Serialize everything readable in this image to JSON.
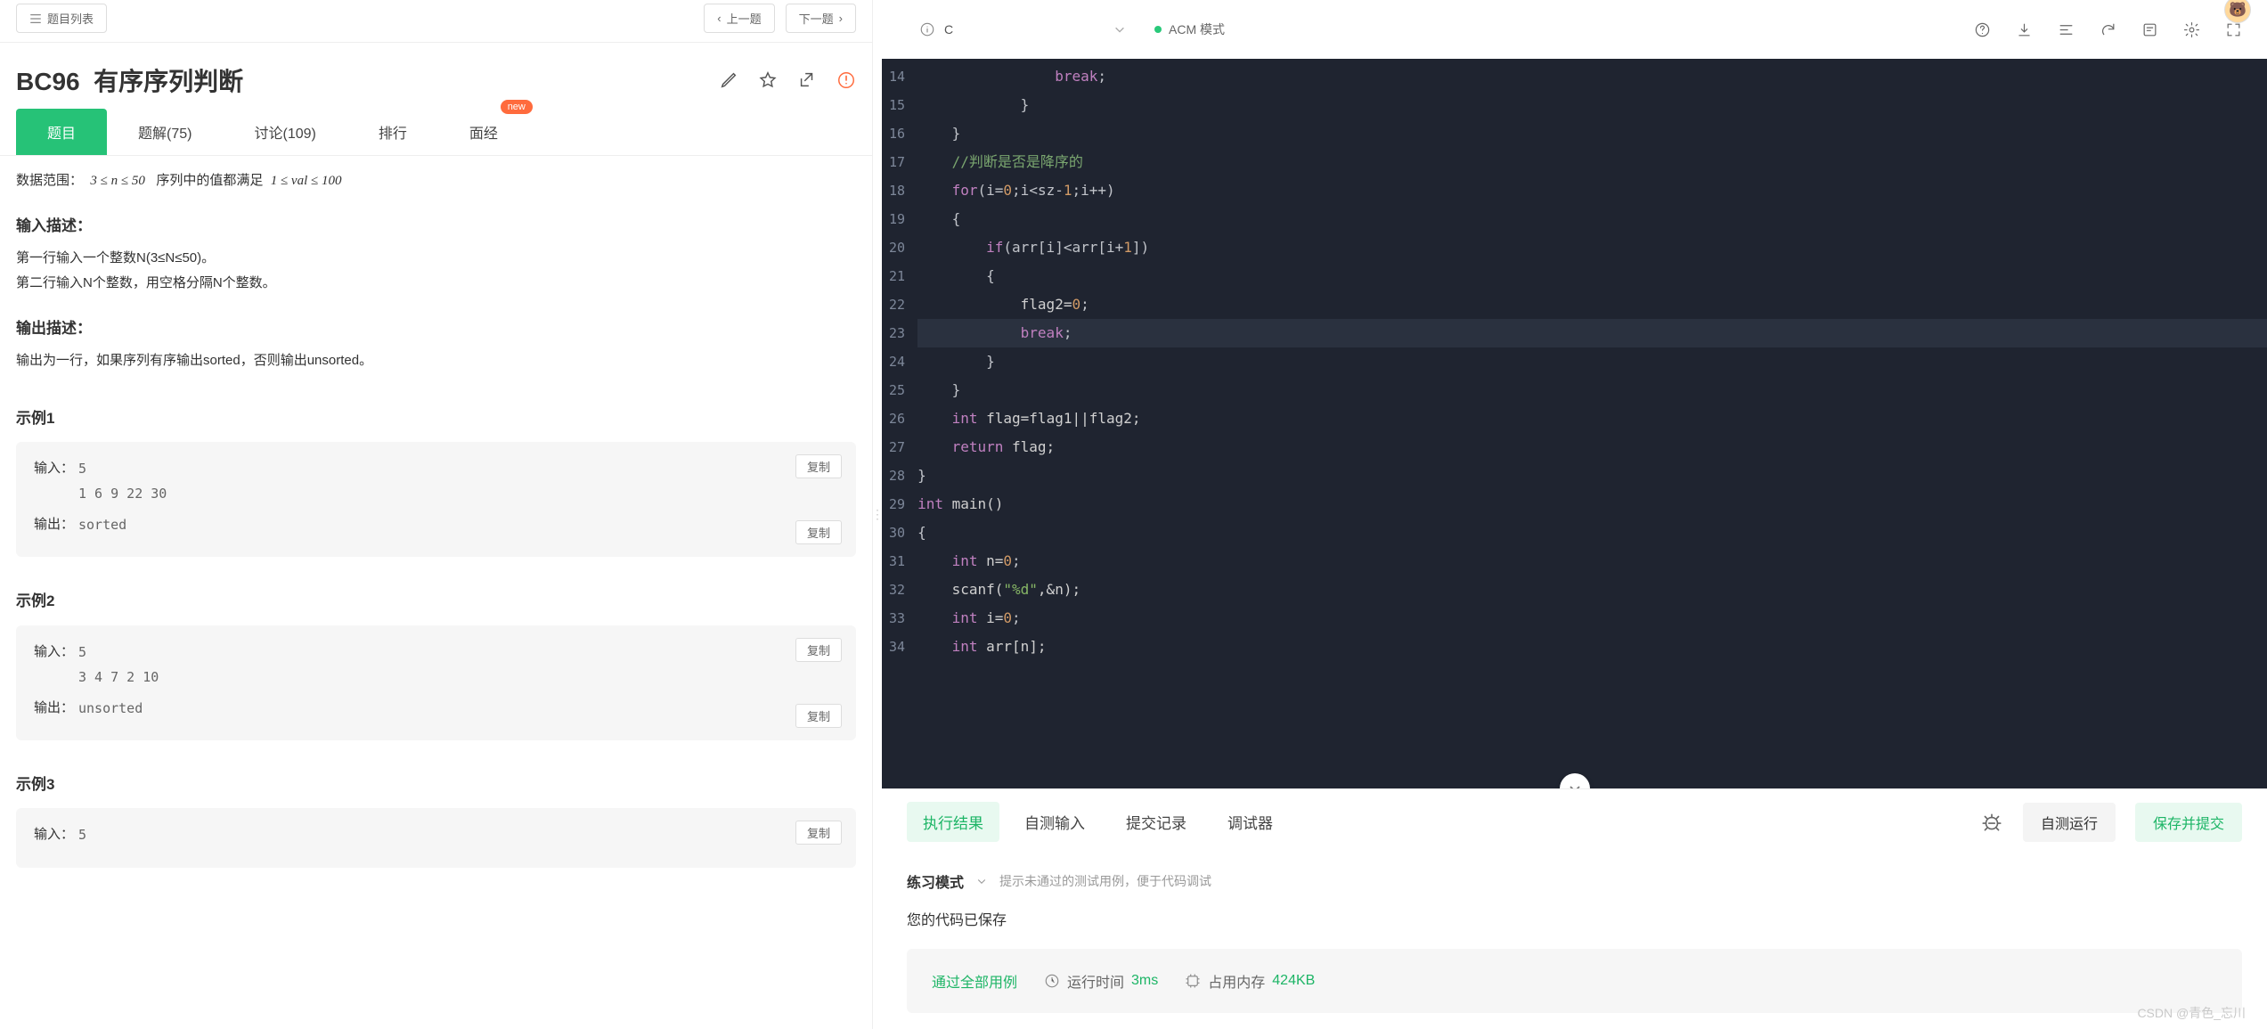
{
  "topnav": {
    "list": "题目列表",
    "prev": "上一题",
    "next": "下一题"
  },
  "problem": {
    "code": "BC96",
    "title": "有序序列判断"
  },
  "ptabs": {
    "desc": "题目",
    "solution": "题解(75)",
    "discuss": "讨论(109)",
    "rank": "排行",
    "exp": "面经",
    "new": "new"
  },
  "body": {
    "range_label": "数据范围：",
    "range_math": "3 ≤ n ≤ 50",
    "range_mid": "序列中的值都满足",
    "range_math2": "1 ≤ val ≤ 100",
    "in_h": "输入描述：",
    "in_l1": "第一行输入一个整数N(3≤N≤50)。",
    "in_l2": "第二行输入N个整数，用空格分隔N个整数。",
    "out_h": "输出描述：",
    "out_l1": "输出为一行，如果序列有序输出sorted，否则输出unsorted。"
  },
  "samples": {
    "s1": "示例1",
    "s2": "示例2",
    "s3": "示例3",
    "lbl_in": "输入：",
    "lbl_out": "输出：",
    "copy": "复制",
    "e1_in": "5\n1 6 9 22 30",
    "e1_out": "sorted",
    "e2_in": "5\n3 4 7 2 10",
    "e2_out": "unsorted",
    "e3_in": "5"
  },
  "editor": {
    "lang": "C",
    "mode": "ACM 模式",
    "lines": [
      {
        "n": 14,
        "t": "                break;",
        "hl": false,
        "seg": [
          {
            "c": "kw",
            "t": "break"
          },
          {
            "c": "bk",
            "t": ";"
          }
        ],
        "ind": 16
      },
      {
        "n": 15,
        "t": "            }",
        "seg": [
          {
            "c": "bk",
            "t": "}"
          }
        ],
        "ind": 12
      },
      {
        "n": 16,
        "t": "    }",
        "seg": [
          {
            "c": "bk",
            "t": "}"
          }
        ],
        "ind": 4
      },
      {
        "n": 17,
        "t": "    //判断是否是降序的",
        "seg": [
          {
            "c": "cmt",
            "t": "//判断是否是降序的"
          }
        ],
        "ind": 4
      },
      {
        "n": 18,
        "t": "    for(i=0;i<sz-1;i++)",
        "seg": [
          {
            "c": "kw",
            "t": "for"
          },
          {
            "c": "bk",
            "t": "(i="
          },
          {
            "c": "num",
            "t": "0"
          },
          {
            "c": "bk",
            "t": ";i<sz-"
          },
          {
            "c": "num",
            "t": "1"
          },
          {
            "c": "bk",
            "t": ";i++)"
          }
        ],
        "ind": 4
      },
      {
        "n": 19,
        "t": "    {",
        "seg": [
          {
            "c": "bk",
            "t": "{"
          }
        ],
        "ind": 4
      },
      {
        "n": 20,
        "t": "        if(arr[i]<arr[i+1])",
        "seg": [
          {
            "c": "kw",
            "t": "if"
          },
          {
            "c": "bk",
            "t": "(arr[i]<arr[i+"
          },
          {
            "c": "num",
            "t": "1"
          },
          {
            "c": "bk",
            "t": "])"
          }
        ],
        "ind": 8
      },
      {
        "n": 21,
        "t": "        {",
        "seg": [
          {
            "c": "bk",
            "t": "{"
          }
        ],
        "ind": 8,
        "box": true
      },
      {
        "n": 22,
        "t": "            flag2=0;",
        "seg": [
          {
            "c": "id",
            "t": "flag2="
          },
          {
            "c": "num",
            "t": "0"
          },
          {
            "c": "bk",
            "t": ";"
          }
        ],
        "ind": 12
      },
      {
        "n": 23,
        "t": "            break;",
        "hl": true,
        "seg": [
          {
            "c": "kw",
            "t": "break"
          },
          {
            "c": "bk",
            "t": ";"
          }
        ],
        "ind": 12
      },
      {
        "n": 24,
        "t": "        }",
        "seg": [
          {
            "c": "bk",
            "t": "}"
          }
        ],
        "ind": 8,
        "box": true
      },
      {
        "n": 25,
        "t": "    }",
        "seg": [
          {
            "c": "bk",
            "t": "}"
          }
        ],
        "ind": 4
      },
      {
        "n": 26,
        "t": "    int flag=flag1||flag2;",
        "seg": [
          {
            "c": "kw",
            "t": "int"
          },
          {
            "c": "id",
            "t": " flag=flag1||flag2;"
          }
        ],
        "ind": 4
      },
      {
        "n": 27,
        "t": "    return flag;",
        "seg": [
          {
            "c": "kw",
            "t": "return"
          },
          {
            "c": "id",
            "t": " flag;"
          }
        ],
        "ind": 4
      },
      {
        "n": 28,
        "t": "}",
        "seg": [
          {
            "c": "bk",
            "t": "}"
          }
        ],
        "ind": 0
      },
      {
        "n": 29,
        "t": "int main()",
        "seg": [
          {
            "c": "kw",
            "t": "int"
          },
          {
            "c": "id",
            "t": " main()"
          }
        ],
        "ind": 0
      },
      {
        "n": 30,
        "t": "{",
        "seg": [
          {
            "c": "bk",
            "t": "{"
          }
        ],
        "ind": 0
      },
      {
        "n": 31,
        "t": "    int n=0;",
        "seg": [
          {
            "c": "kw",
            "t": "int"
          },
          {
            "c": "id",
            "t": " n="
          },
          {
            "c": "num",
            "t": "0"
          },
          {
            "c": "bk",
            "t": ";"
          }
        ],
        "ind": 4
      },
      {
        "n": 32,
        "t": "    scanf(\"%d\",&n);",
        "seg": [
          {
            "c": "id",
            "t": "scanf("
          },
          {
            "c": "str",
            "t": "\"%d\""
          },
          {
            "c": "id",
            "t": ",&n);"
          }
        ],
        "ind": 4
      },
      {
        "n": 33,
        "t": "    int i=0;",
        "seg": [
          {
            "c": "kw",
            "t": "int"
          },
          {
            "c": "id",
            "t": " i="
          },
          {
            "c": "num",
            "t": "0"
          },
          {
            "c": "bk",
            "t": ";"
          }
        ],
        "ind": 4
      },
      {
        "n": 34,
        "t": "    int arr[n];",
        "seg": [
          {
            "c": "kw",
            "t": "int"
          },
          {
            "c": "id",
            "t": " arr[n];"
          }
        ],
        "ind": 4
      }
    ]
  },
  "output": {
    "tabs": {
      "result": "执行结果",
      "selftest": "自测输入",
      "history": "提交记录",
      "debug": "调试器"
    },
    "btns": {
      "run": "自测运行",
      "submit": "保存并提交"
    },
    "mode": "练习模式",
    "mode_hint": "提示未通过的测试用例，便于代码调试",
    "saved": "您的代码已保存",
    "pass": "通过全部用例",
    "time_l": "运行时间",
    "time_v": "3ms",
    "mem_l": "占用内存",
    "mem_v": "424KB"
  },
  "watermark": "CSDN @青色_忘川"
}
